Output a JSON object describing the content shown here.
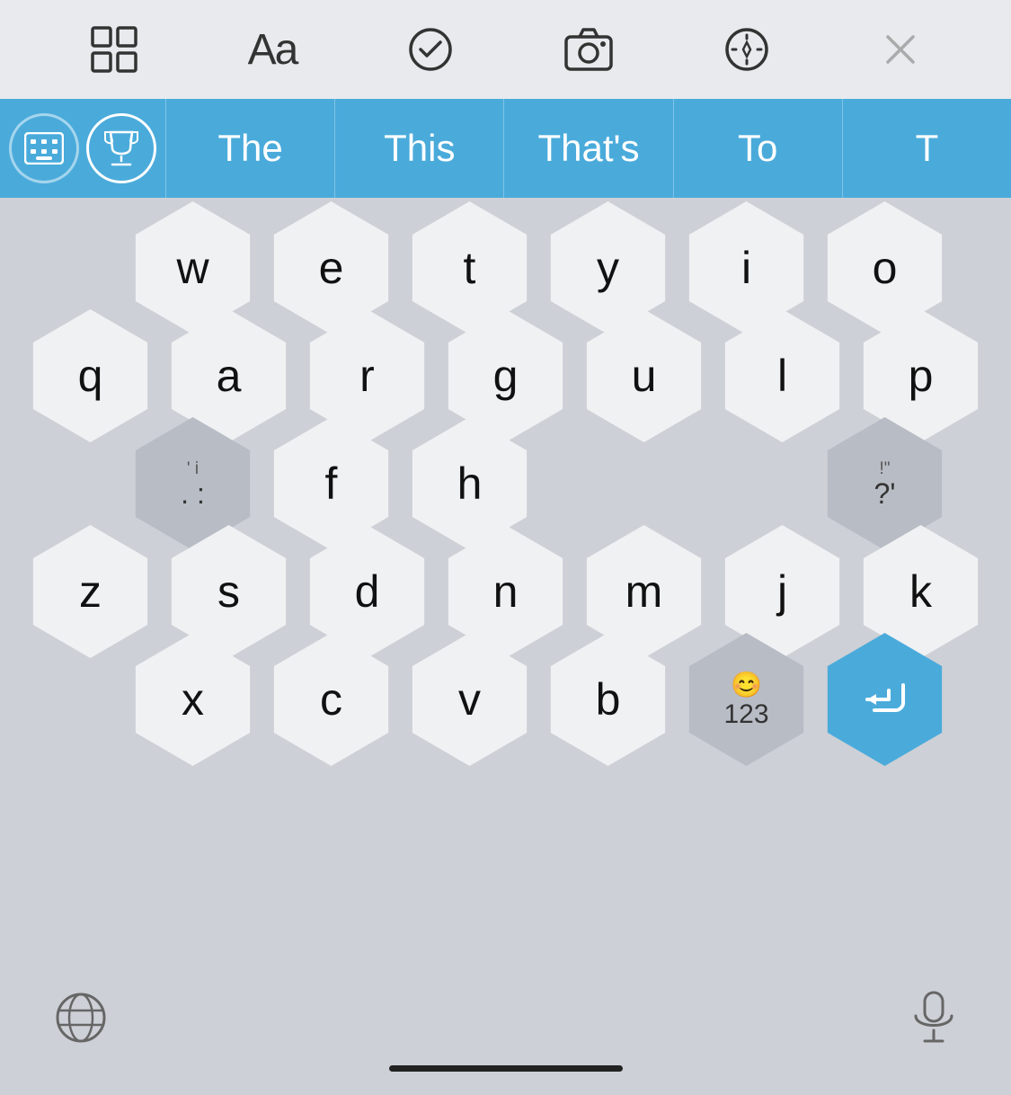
{
  "toolbar": {
    "icons": [
      "grid-icon",
      "text-icon",
      "check-icon",
      "camera-icon",
      "pen-icon",
      "close-icon"
    ]
  },
  "suggestion_bar": {
    "icon1": "keyboard-icon",
    "icon2": "trophy-icon",
    "words": [
      "The",
      "This",
      "That's",
      "To",
      "T"
    ]
  },
  "keyboard": {
    "rows": [
      [
        {
          "key": "w",
          "top": ""
        },
        {
          "key": "e",
          "top": ""
        },
        {
          "key": "t",
          "top": ""
        },
        {
          "key": "y",
          "top": ""
        },
        {
          "key": "i",
          "top": ""
        },
        {
          "key": "o",
          "top": ""
        }
      ],
      [
        {
          "key": "q",
          "top": ""
        },
        {
          "key": "a",
          "top": ""
        },
        {
          "key": "r",
          "top": ""
        },
        {
          "key": "g",
          "top": ""
        },
        {
          "key": "u",
          "top": ""
        },
        {
          "key": "l",
          "top": ""
        },
        {
          "key": "p",
          "top": ""
        }
      ],
      [
        {
          "key": ",;",
          "top": "' i",
          "type": "special"
        },
        {
          "key": "f",
          "top": ""
        },
        {
          "key": "h",
          "top": ""
        },
        {
          "key": "?'",
          "top": "!\"",
          "type": "special"
        }
      ],
      [
        {
          "key": "z",
          "top": ""
        },
        {
          "key": "s",
          "top": ""
        },
        {
          "key": "d",
          "top": ""
        },
        {
          "key": "n",
          "top": ""
        },
        {
          "key": "m",
          "top": ""
        },
        {
          "key": "j",
          "top": ""
        },
        {
          "key": "k",
          "top": ""
        }
      ],
      [
        {
          "key": "x",
          "top": ""
        },
        {
          "key": "c",
          "top": ""
        },
        {
          "key": "v",
          "top": ""
        },
        {
          "key": "b",
          "top": ""
        },
        {
          "key": "123",
          "top": "😊",
          "type": "numeric"
        },
        {
          "key": "⏎",
          "top": "",
          "type": "return"
        }
      ]
    ]
  },
  "bottom_bar": {
    "globe_label": "🌐",
    "mic_label": "🎤"
  }
}
